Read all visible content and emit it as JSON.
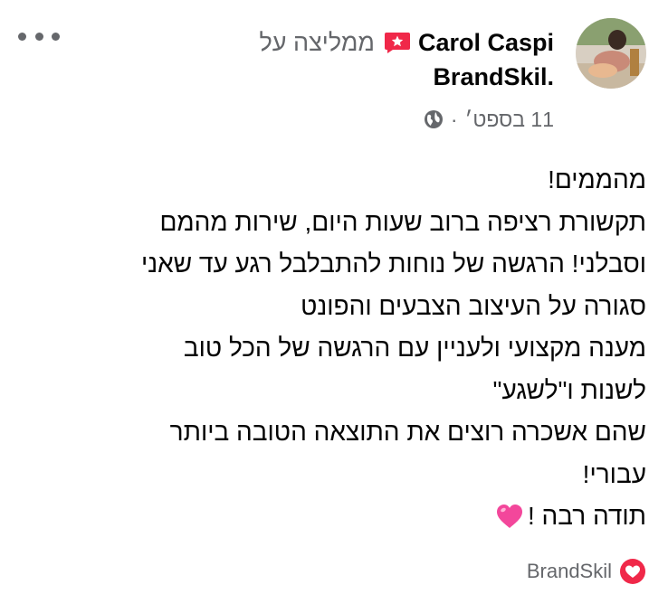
{
  "post": {
    "author": "Carol Caspi",
    "recommend_text": "ממליצה על",
    "page_name_line": ".BrandSkil",
    "date": "11 בספט׳",
    "separator": "·",
    "body_lines": [
      "מהממים!",
      "תקשורת רציפה ברוב שעות היום, שירות מהמם",
      "וסבלני! הרגשה של נוחות להתבלבל רגע עד שאני",
      "סגורה על העיצוב הצבעים והפונט",
      "מענה מקצועי ולעניין  עם הרגשה של הכל טוב",
      "לשנות ו\"לשגע\"",
      "שהם אשכרה רוצים את התוצאה הטובה ביותר",
      "עבורי!",
      "תודה רבה !"
    ],
    "page_tag": "BrandSkil"
  },
  "colors": {
    "text_primary": "#050505",
    "text_secondary": "#65676b",
    "recommend_red": "#f02849",
    "heart_pink": "#f3479b"
  },
  "icons": {
    "more": "more-dots-icon",
    "recommend": "recommend-badge-icon",
    "audience": "globe-icon",
    "emoji": "pink-heart-emoji",
    "page_reaction": "heart-reaction-icon"
  }
}
